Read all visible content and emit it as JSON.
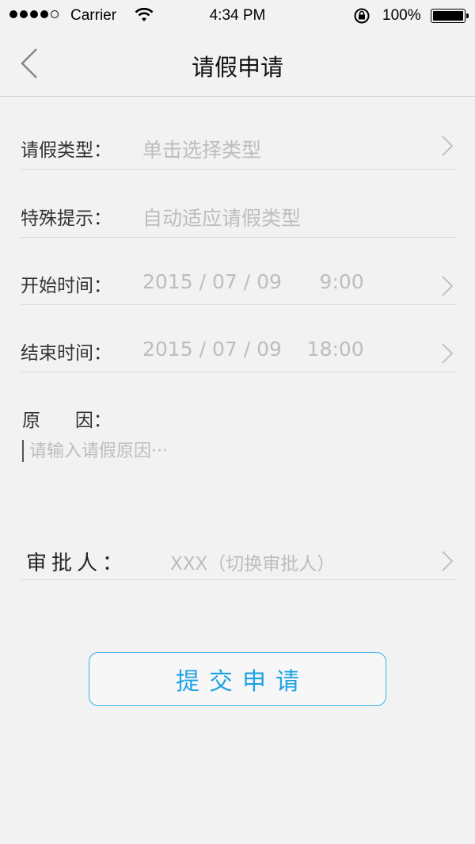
{
  "status": {
    "carrier": "Carrier",
    "time": "4:34 PM",
    "battery": "100%"
  },
  "nav": {
    "title": "请假申请",
    "back_icon": "chevron-left-icon"
  },
  "form": {
    "type": {
      "label": "请假类型：",
      "value": "单击选择类型"
    },
    "hint": {
      "label": "特殊提示：",
      "value": "自动适应请假类型"
    },
    "start": {
      "label": "开始时间：",
      "value": "2015 / 07 / 09      9:00"
    },
    "end": {
      "label": "结束时间：",
      "value": "2015 / 07 / 09    18:00"
    },
    "reason": {
      "label": "原      因：",
      "placeholder": "请输入请假原因···"
    },
    "approver": {
      "label": "审批人：",
      "value": "XXX（切换审批人）"
    }
  },
  "submit_label": "提交申请",
  "colors": {
    "accent": "#1ea2e6",
    "background": "#f2f2f2",
    "placeholder": "#bdbdbd"
  }
}
